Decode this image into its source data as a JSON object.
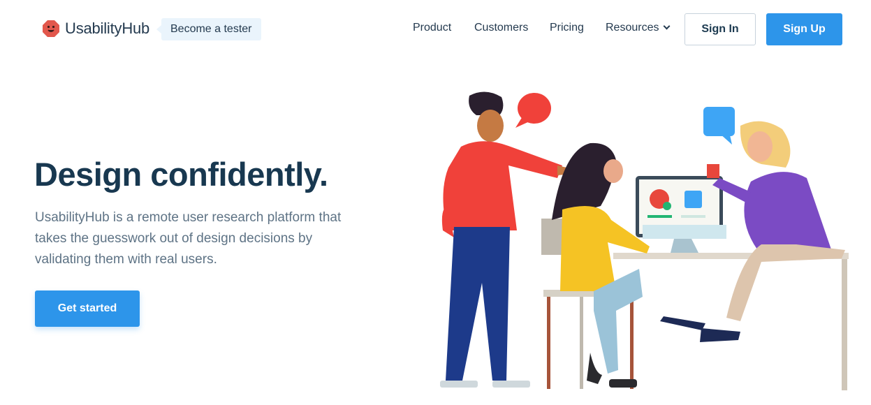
{
  "brand": {
    "name": "UsabilityHub",
    "tester_badge": "Become a tester",
    "logo_color": "#e2574c"
  },
  "nav": {
    "product": "Product",
    "customers": "Customers",
    "pricing": "Pricing",
    "resources": "Resources",
    "sign_in": "Sign In",
    "sign_up": "Sign Up"
  },
  "hero": {
    "title": "Design confidently.",
    "subtitle": "UsabilityHub is a remote user research platform that takes the guesswork out of design decisions by validating them with real users.",
    "cta": "Get started"
  },
  "colors": {
    "accent": "#2d95ea",
    "heading": "#183850",
    "body_text": "#5e7385"
  },
  "icons": {
    "logo": "usabilityhub-logo-icon",
    "resources_dropdown": "chevron-down-icon"
  }
}
